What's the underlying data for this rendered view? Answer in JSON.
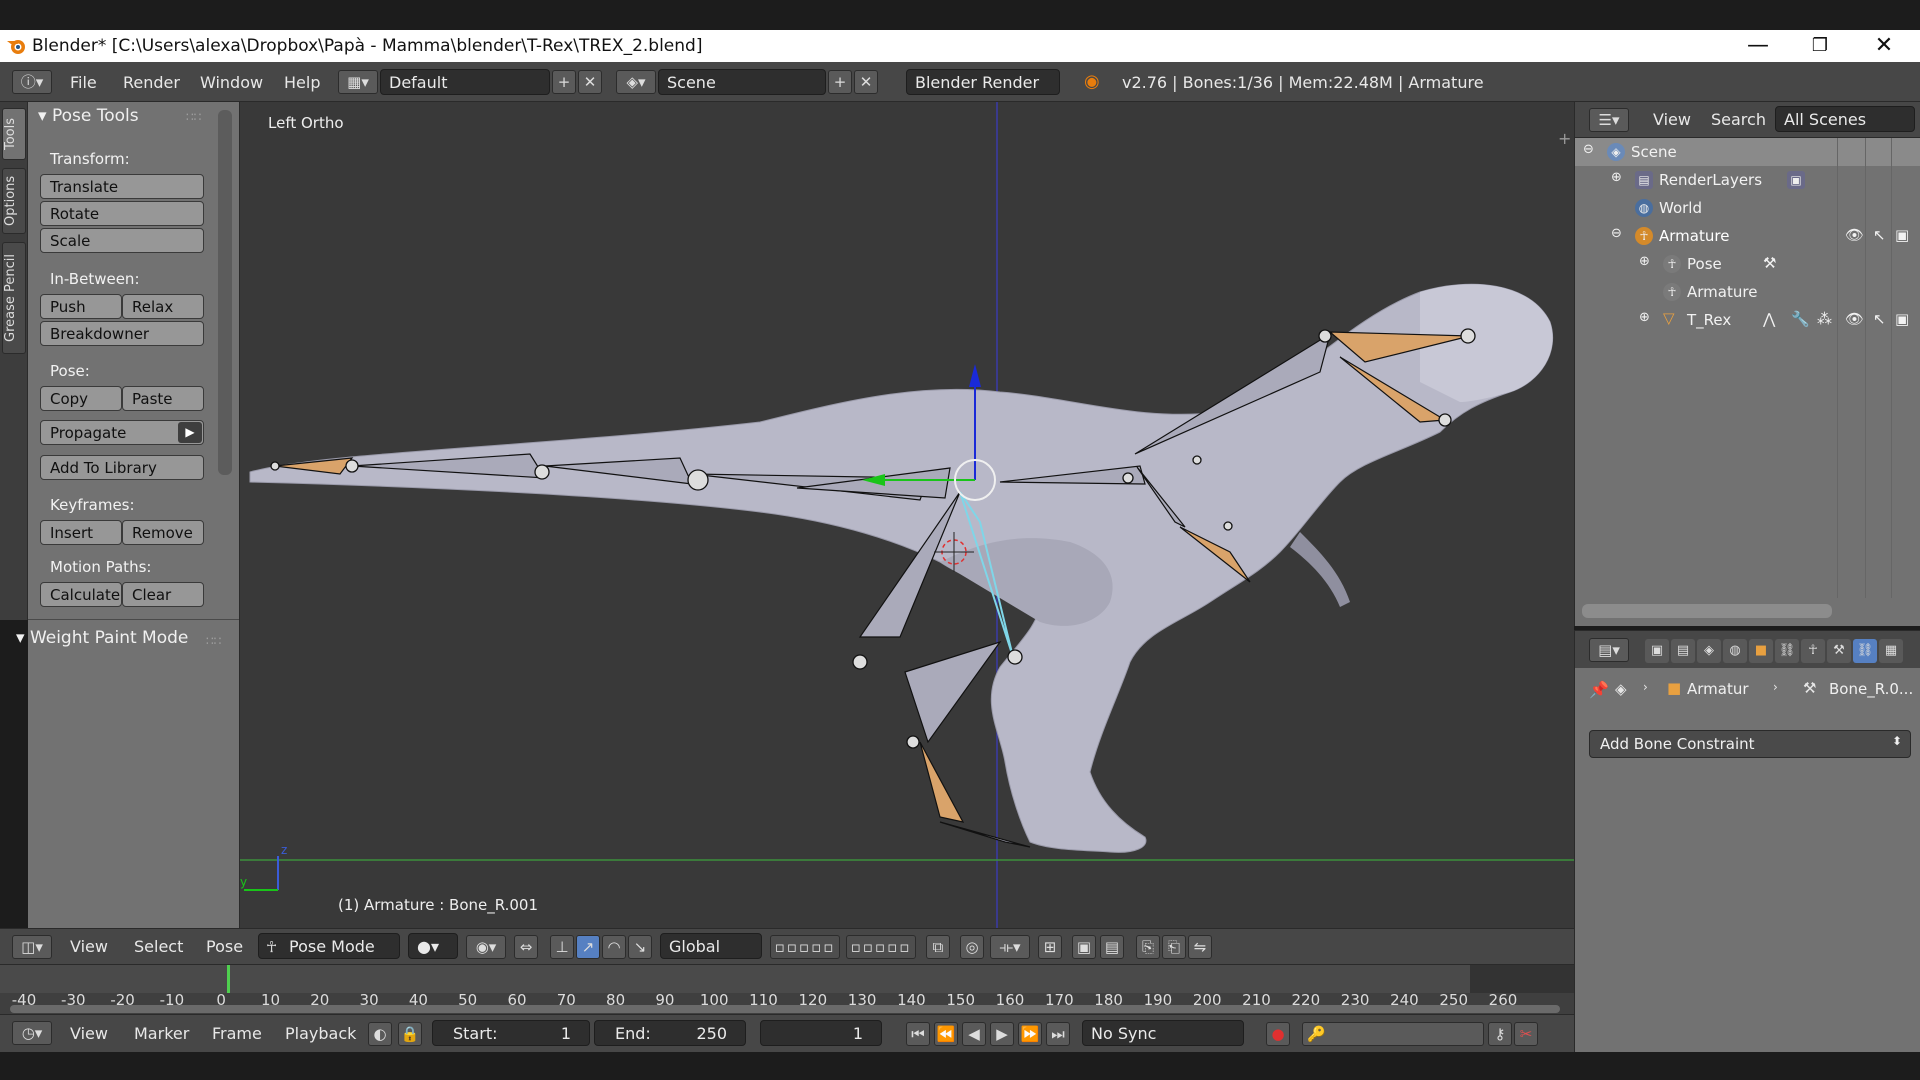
{
  "window": {
    "title": "Blender* [C:\\Users\\alexa\\Dropbox\\Papà - Mamma\\blender\\T-Rex\\TREX_2.blend]",
    "minimize": "—",
    "maximize": "❐",
    "close": "✕"
  },
  "info_header": {
    "menus": [
      "File",
      "Render",
      "Window",
      "Help"
    ],
    "screen_layout": "Default",
    "scene": "Scene",
    "render_engine": "Blender Render",
    "stats": "v2.76 | Bones:1/36 | Mem:22.48M | Armature"
  },
  "tool_tabs": [
    "Tools",
    "Options",
    "Grease Pencil"
  ],
  "tool_shelf": {
    "panel_title": "Pose Tools",
    "sections": {
      "transform": "Transform:",
      "in_between": "In-Between:",
      "pose": "Pose:",
      "keyframes": "Keyframes:",
      "motion_paths": "Motion Paths:"
    },
    "buttons": {
      "translate": "Translate",
      "rotate": "Rotate",
      "scale": "Scale",
      "push": "Push",
      "relax": "Relax",
      "breakdowner": "Breakdowner",
      "copy": "Copy",
      "paste": "Paste",
      "propagate": "Propagate",
      "add_to_library": "Add To Library",
      "insert": "Insert",
      "remove": "Remove",
      "calculate": "Calculate",
      "clear": "Clear"
    },
    "panel2_title": "Weight Paint Mode"
  },
  "viewport": {
    "view_label": "Left Ortho",
    "status": "(1) Armature : Bone_R.001",
    "axis_z": "z",
    "axis_y": "y"
  },
  "viewport_header": {
    "menus": [
      "View",
      "Select",
      "Pose"
    ],
    "mode": "Pose Mode",
    "orientation": "Global"
  },
  "timeline": {
    "ticks": [
      "-40",
      "-30",
      "-20",
      "-10",
      "0",
      "10",
      "20",
      "30",
      "40",
      "50",
      "60",
      "70",
      "80",
      "90",
      "100",
      "110",
      "120",
      "130",
      "140",
      "150",
      "160",
      "170",
      "180",
      "190",
      "200",
      "210",
      "220",
      "230",
      "240",
      "250",
      "260"
    ],
    "current_frame_marker": 0
  },
  "timeline_header": {
    "menus": [
      "View",
      "Marker",
      "Frame",
      "Playback"
    ],
    "start_label": "Start:",
    "start_value": "1",
    "end_label": "End:",
    "end_value": "250",
    "current_frame": "1",
    "sync": "No Sync"
  },
  "outliner": {
    "header_menus": [
      "View",
      "Search"
    ],
    "filter": "All Scenes",
    "rows": [
      "Scene",
      "RenderLayers",
      "World",
      "Armature",
      "Pose",
      "Armature",
      "T_Rex"
    ]
  },
  "properties": {
    "breadcrumb_object": "Armatur",
    "breadcrumb_bone": "Bone_R.0...",
    "add_constraint": "Add Bone Constraint"
  },
  "colors": {
    "viewport_bg": "#393939",
    "panel_bg": "#727272",
    "header_bg": "#474747",
    "bone_selected": "#7fd6e8",
    "bone_tip": "#d9a36a",
    "x_axis_line": "#3c8f3c",
    "z_axis_line": "#3a3aa8"
  }
}
